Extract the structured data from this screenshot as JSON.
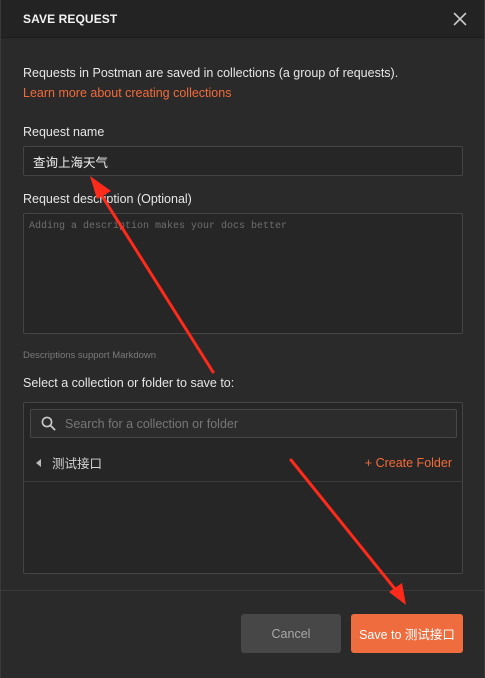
{
  "dialog": {
    "title": "SAVE REQUEST",
    "close_icon": "close-icon"
  },
  "intro": {
    "text": "Requests in Postman are saved in collections (a group of requests).",
    "link": "Learn more about creating collections"
  },
  "request_name": {
    "label": "Request name",
    "value": "查询上海天气"
  },
  "request_description": {
    "label": "Request description (Optional)",
    "placeholder": "Adding a description makes your docs better",
    "hint": "Descriptions support Markdown"
  },
  "collection": {
    "label": "Select a collection or folder to save to:",
    "search_placeholder": "Search for a collection or folder",
    "search_icon": "search-icon",
    "current_folder": "测试接口",
    "create_folder": "+ Create Folder"
  },
  "footer": {
    "cancel_label": "Cancel",
    "save_label": "Save to 测试接口"
  },
  "colors": {
    "accent": "#ef6c3e",
    "annotation_arrow": "#ff2a1a",
    "background": "#2a2a2a"
  }
}
